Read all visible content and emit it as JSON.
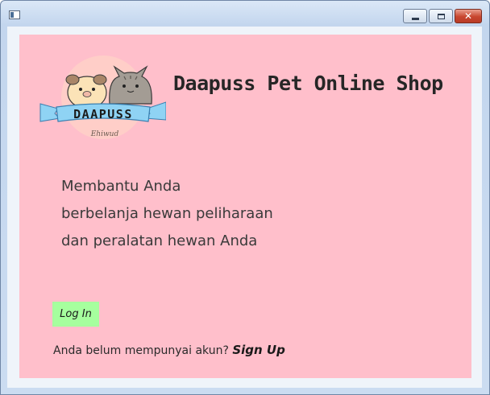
{
  "window": {
    "close_glyph": "✕"
  },
  "header": {
    "logo_text": "DAAPUSS",
    "logo_sub": "Ehiwud",
    "title": "Daapuss Pet Online Shop"
  },
  "tagline": {
    "lines": [
      "Membantu Anda",
      "berbelanja hewan peliharaan",
      "dan peralatan hewan Anda"
    ]
  },
  "login": {
    "button_label": "Log In"
  },
  "signup": {
    "prompt": "Anda belum mempunyai akun?",
    "link_label": "Sign Up"
  },
  "colors": {
    "panel_bg": "#ffbfcb",
    "login_bg": "#a6ff9e",
    "logo_ribbon": "#8fd3f4"
  }
}
